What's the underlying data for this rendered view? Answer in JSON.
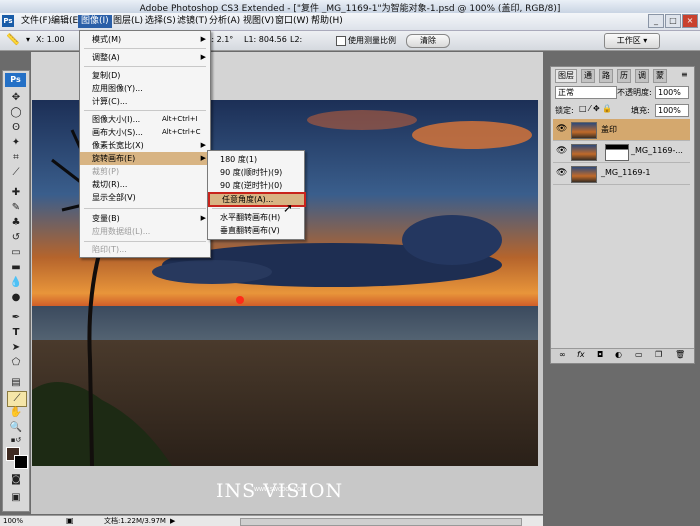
{
  "app": {
    "title": "Adobe Photoshop CS3 Extended - [\"复件 _MG_1169-1\"为智能对象-1.psd @ 100% (盖印, RGB/8)]"
  },
  "menubar": {
    "logo": "Ps",
    "items": [
      "文件(F)",
      "编辑(E)",
      "图像(I)",
      "图层(L)",
      "选择(S)",
      "滤镜(T)",
      "分析(A)",
      "视图(V)",
      "窗口(W)",
      "帮助(H)"
    ],
    "window_buttons": [
      "_",
      "□",
      "×"
    ]
  },
  "options_bar": {
    "x": "X: 1.00",
    "angle": "A: 2.1°",
    "l1": "L1: 804.56",
    "l2": "L2:",
    "measure_scale": "使用测量比例",
    "clear": "清除",
    "workspace": "工作区 ▾"
  },
  "toolbox": {
    "logo": "Ps"
  },
  "image_menu": {
    "items": [
      {
        "label": "模式(M)",
        "shortcut": "",
        "arrow": "▶",
        "disabled": false
      },
      {
        "label": "调整(A)",
        "shortcut": "",
        "arrow": "▶",
        "disabled": false
      },
      {
        "label": "复制(D)",
        "shortcut": "",
        "arrow": "",
        "disabled": false
      },
      {
        "label": "应用图像(Y)...",
        "shortcut": "",
        "arrow": "",
        "disabled": false
      },
      {
        "label": "计算(C)...",
        "shortcut": "",
        "arrow": "",
        "disabled": false
      },
      {
        "label": "图像大小(I)...",
        "shortcut": "Alt+Ctrl+I",
        "arrow": "",
        "disabled": false
      },
      {
        "label": "画布大小(S)...",
        "shortcut": "Alt+Ctrl+C",
        "arrow": "",
        "disabled": false
      },
      {
        "label": "像素长宽比(X)",
        "shortcut": "",
        "arrow": "▶",
        "disabled": false
      },
      {
        "label": "旋转画布(E)",
        "shortcut": "",
        "arrow": "▶",
        "disabled": false,
        "highlight": true
      },
      {
        "label": "裁剪(P)",
        "shortcut": "",
        "arrow": "",
        "disabled": true
      },
      {
        "label": "裁切(R)...",
        "shortcut": "",
        "arrow": "",
        "disabled": false
      },
      {
        "label": "显示全部(V)",
        "shortcut": "",
        "arrow": "",
        "disabled": false
      },
      {
        "label": "变量(B)",
        "shortcut": "",
        "arrow": "▶",
        "disabled": false
      },
      {
        "label": "应用数据组(L)...",
        "shortcut": "",
        "arrow": "",
        "disabled": true
      },
      {
        "label": "陷印(T)...",
        "shortcut": "",
        "arrow": "",
        "disabled": true
      }
    ]
  },
  "rotate_submenu": {
    "items": [
      {
        "label": "180 度(1)"
      },
      {
        "label": "90 度(顺时针)(9)"
      },
      {
        "label": "90 度(逆时针)(0)"
      },
      {
        "label": "任意角度(A)...",
        "highlight": true
      },
      {
        "label": "水平翻转画布(H)"
      },
      {
        "label": "垂直翻转画布(V)"
      }
    ]
  },
  "layers_panel": {
    "tabs": [
      "图层",
      "通",
      "路",
      "历",
      "调",
      "蒙"
    ],
    "blend_mode": "正常",
    "opacity_label": "不透明度:",
    "opacity": "100%",
    "lock_label": "锁定:",
    "fill_label": "填充:",
    "fill": "100%",
    "layers": [
      {
        "name": "盖印",
        "selected": true
      },
      {
        "name": "_MG_1169-...",
        "selected": false
      },
      {
        "name": "_MG_1169-1",
        "selected": false
      }
    ],
    "footer_icons": [
      "link-icon",
      "fx-icon",
      "mask-icon",
      "adjustment-icon",
      "group-icon",
      "new-layer-icon",
      "trash-icon"
    ]
  },
  "document": {
    "watermark": "INS VISION",
    "watermark_sub": "WWW.SWCOOL.COM"
  },
  "status_bar": {
    "zoom": "100%",
    "doc_info": "文档:1.22M/3.97M"
  }
}
